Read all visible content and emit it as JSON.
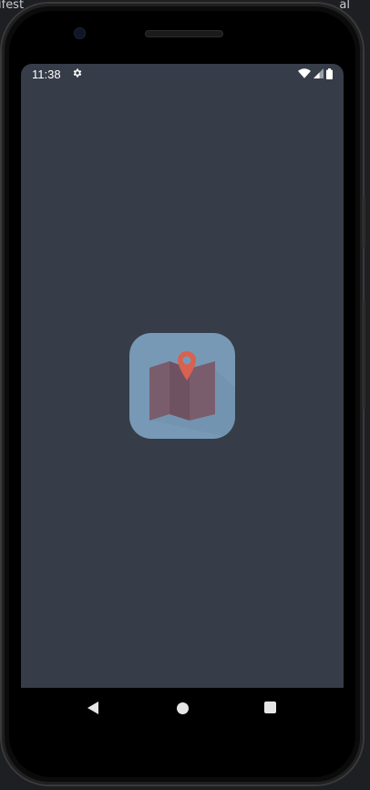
{
  "ide": {
    "left_fragment": "ifest",
    "right_fragment": "al"
  },
  "status_bar": {
    "time": "11:38",
    "icons": [
      "settings-icon",
      "wifi-icon",
      "cellular-signal-icon",
      "battery-icon"
    ]
  },
  "splash": {
    "icon": "map-pin-app-icon"
  },
  "nav_bar": {
    "icons": [
      "back-icon",
      "home-icon",
      "recents-icon"
    ]
  },
  "colors": {
    "screen_background": "#363c48",
    "app_icon_background": "#7899b5",
    "map": "#7a5d6c",
    "pin": "#d9614f",
    "nav_buttons": "#e6e6e6"
  }
}
